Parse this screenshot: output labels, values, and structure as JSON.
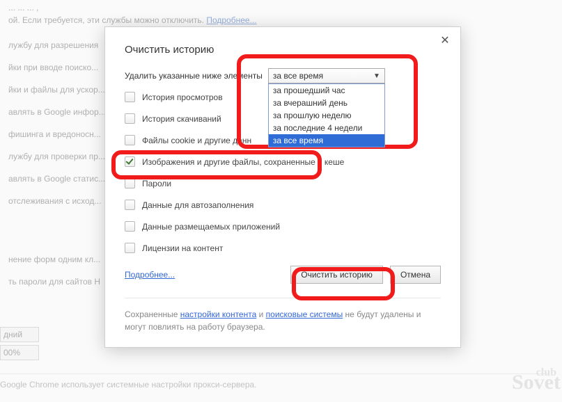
{
  "bg": {
    "l0": "...  ...   ...                        ,                                                         ",
    "l1": "ой. Если требуется, эти службы можно отключить.",
    "l1_link": "Подробнее...",
    "l2": "лужбу для разрешения",
    "l3": "йки при вводе поиско...",
    "l4": "йки и файлы для ускор...",
    "l5": "авлять в Google инфор...",
    "l6": "фишинга и вредоносн...",
    "l7": "лужбу для проверки пр...",
    "l8": "авлять в Google статис...",
    "l9": "отслеживания с исход...",
    "l10": "нение форм одним кл...",
    "l11": "ть пароли для сайтов Н",
    "w1": "дний",
    "w2": "00%",
    "bottom": "Google Chrome использует системные настройки прокси-сервера."
  },
  "dialog": {
    "title": "Очистить историю",
    "prompt": "Удалить указанные ниже элементы",
    "dropdown": {
      "selected": "за все время",
      "options": [
        "за прошедший час",
        "за вчерашний день",
        "за прошлую неделю",
        "за последние 4 недели",
        "за все время"
      ]
    },
    "checks": [
      {
        "label": "История просмотров",
        "checked": false
      },
      {
        "label": "История скачиваний",
        "checked": false
      },
      {
        "label": "Файлы cookie и другие данн",
        "checked": false
      },
      {
        "label": "Изображения и другие файлы, сохраненные в кеше",
        "checked": true
      },
      {
        "label": "Пароли",
        "checked": false
      },
      {
        "label": "Данные для автозаполнения",
        "checked": false
      },
      {
        "label": "Данные размещаемых приложений",
        "checked": false
      },
      {
        "label": "Лицензии на контент",
        "checked": false
      }
    ],
    "learn": "Подробнее...",
    "primary": "Очистить историю",
    "cancel": "Отмена",
    "foot_pre": "Сохраненные ",
    "foot_link1": "настройки контента",
    "foot_mid": " и ",
    "foot_link2": "поисковые системы",
    "foot_post": " не будут удалены и могут повлиять на работу браузера."
  },
  "watermark": {
    "small": "club",
    "big": "Sovet"
  }
}
